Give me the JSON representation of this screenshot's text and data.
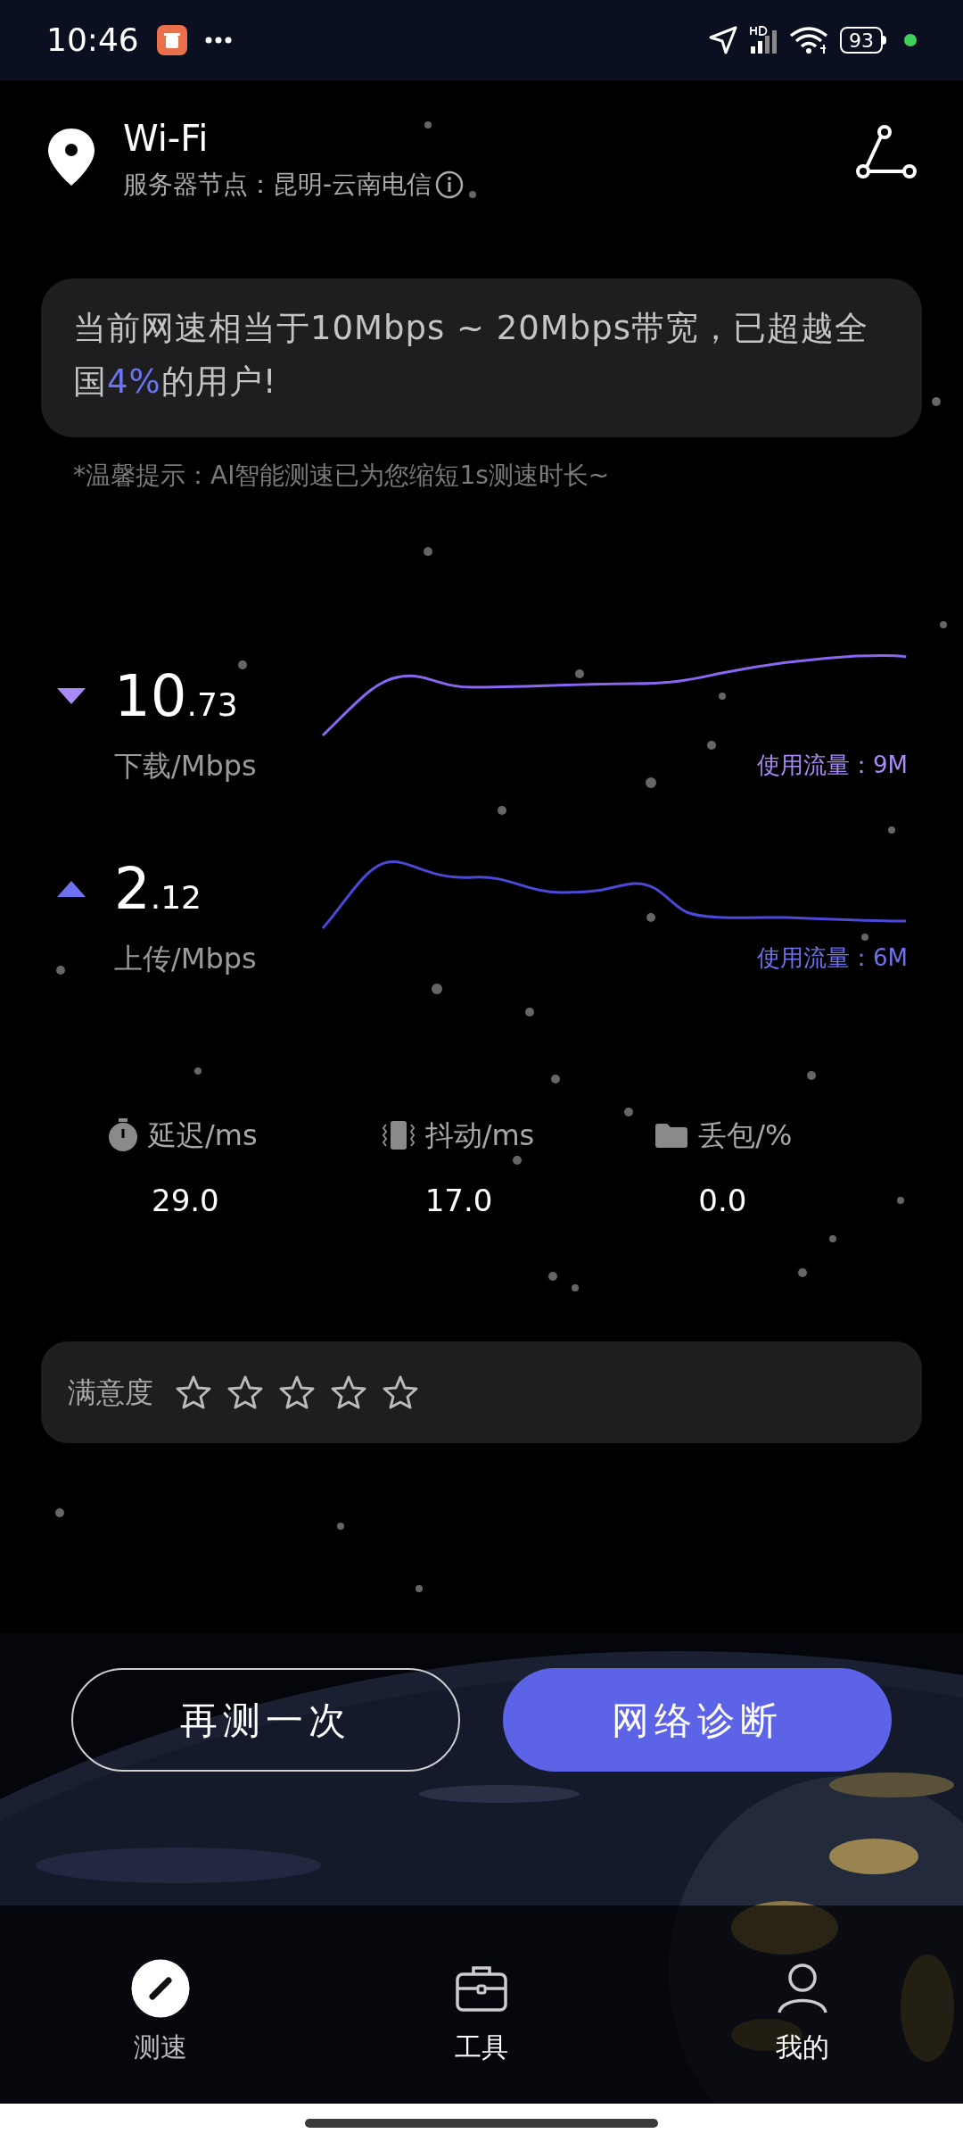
{
  "status_bar": {
    "time": "10:46",
    "battery": "93"
  },
  "header": {
    "title": "Wi-Fi",
    "server": "服务器节点：昆明-云南电信"
  },
  "summary": {
    "before": "当前网速相当于10Mbps ~ 20Mbps带宽，已超越全国",
    "highlight": "4%",
    "after": "的用户!"
  },
  "hint": "*温馨提示：AI智能测速已为您缩短1s测速时长~",
  "speeds": [
    {
      "kind": "download",
      "integer": "10",
      "decimal": ".73",
      "label": "下载/Mbps",
      "usage": "使用流量：9M"
    },
    {
      "kind": "upload",
      "integer": "2",
      "decimal": ".12",
      "label": "上传/Mbps",
      "usage": "使用流量：6M"
    }
  ],
  "stats": [
    {
      "kind": "latency",
      "label": "延迟/ms",
      "value": "29.0"
    },
    {
      "kind": "jitter",
      "label": "抖动/ms",
      "value": "17.0"
    },
    {
      "kind": "loss",
      "label": "丢包/%",
      "value": "0.0"
    }
  ],
  "rating": {
    "label": "满意度",
    "stars": 0
  },
  "buttons": [
    {
      "kind": "outline",
      "label": "再测一次"
    },
    {
      "kind": "primary",
      "label": "网络诊断"
    }
  ],
  "nav": [
    {
      "kind": "speed",
      "label": "测速",
      "selected": true
    },
    {
      "kind": "tools",
      "label": "工具",
      "selected": false
    },
    {
      "kind": "profile",
      "label": "我的",
      "selected": false
    }
  ]
}
